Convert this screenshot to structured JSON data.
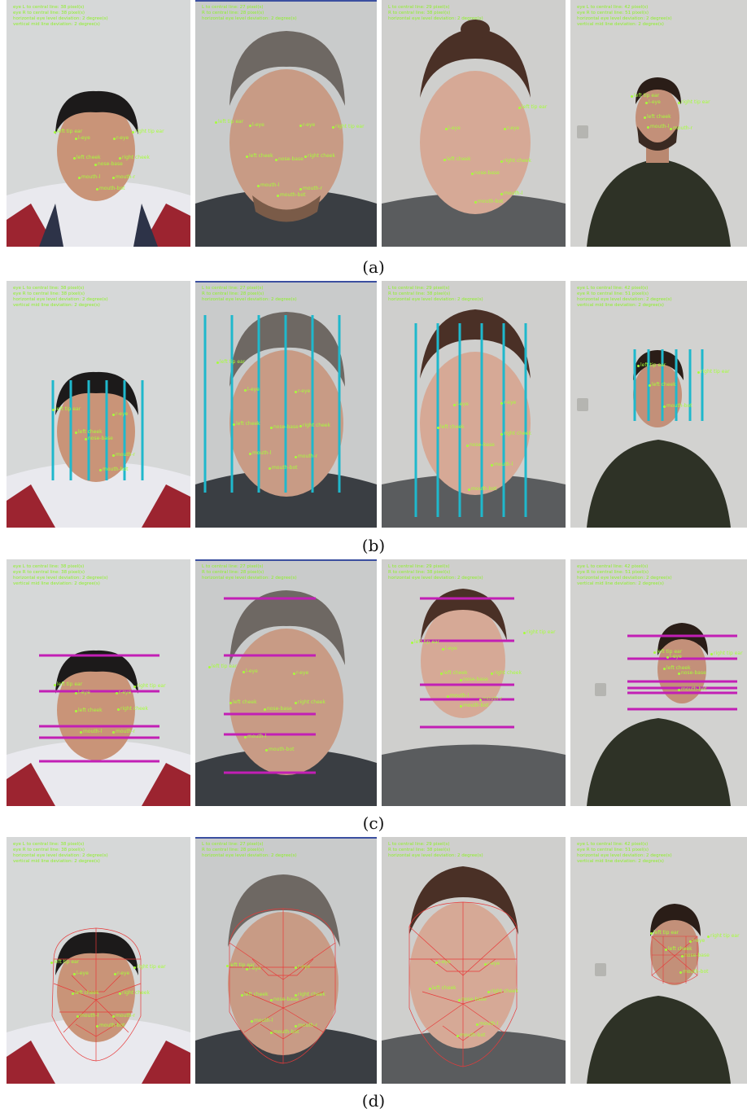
{
  "captions": [
    "(a)",
    "(b)",
    "(c)",
    "(d)"
  ],
  "overlay_text": {
    "p1": [
      "eye L to central line: 38 pixel(s)",
      "eye R to central line: 38 pixel(s)",
      "horizontal eye level deviation: 2 degree(s)",
      "vertical mid line deviation: 2 degree(s)"
    ],
    "p2": [
      "L to central line: 27 pixel(s)",
      "R to central line: 28 pixel(s)",
      "horizontal eye level deviation: 2 degree(s)"
    ],
    "p3": [
      "L to central line: 29 pixel(s)",
      "R to central line: 38 pixel(s)",
      "horizontal eye level deviation: 2 degree(s)"
    ],
    "p4": [
      "eye L to central line: 42 pixel(s)",
      "eye R to central line: 51 pixel(s)",
      "horizontal eye level deviation: 2 degree(s)",
      "vertical mid line deviation: 2 degree(s)"
    ]
  },
  "landmarks": {
    "left_tip_ear": "left tip ear",
    "right_tip_ear": "right tip ear",
    "l_eye": "l-eye",
    "r_eye": "r-eye",
    "left_cheek": "left cheek",
    "right_cheek": "right cheek",
    "nose_base": "nose-base",
    "mouth_l": "mouth-l",
    "mouth_r": "mouth-r",
    "mouth_bot": "mouth-bot"
  },
  "colors": {
    "landmark": "#a6ff3a",
    "vertical_lines": "#1fb8cc",
    "horizontal_lines": "#c21fb5",
    "mesh": "#e83a3a"
  }
}
